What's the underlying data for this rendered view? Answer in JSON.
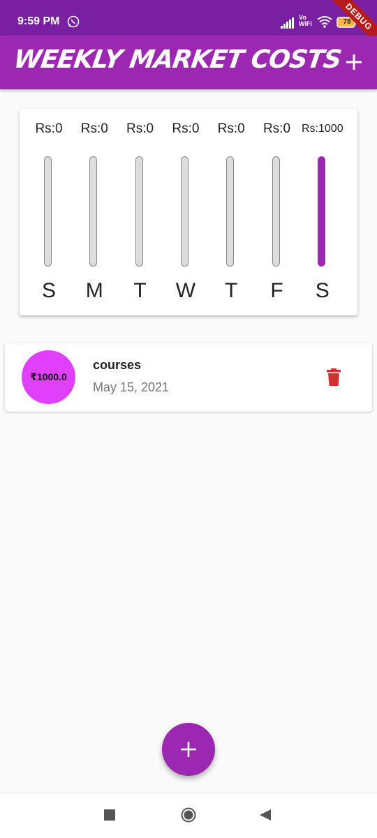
{
  "status_bar": {
    "time": "9:59 PM",
    "network_label": "Vo\nWiFi",
    "battery": "78",
    "debug_banner": "DEBUG"
  },
  "app_bar": {
    "title": "WEEKLY MARKET COSTS",
    "add_icon": "plus-icon"
  },
  "chart": {
    "days": [
      {
        "label": "S",
        "amount": "Rs:0",
        "value": 0
      },
      {
        "label": "M",
        "amount": "Rs:0",
        "value": 0
      },
      {
        "label": "T",
        "amount": "Rs:0",
        "value": 0
      },
      {
        "label": "W",
        "amount": "Rs:0",
        "value": 0
      },
      {
        "label": "T",
        "amount": "Rs:0",
        "value": 0
      },
      {
        "label": "F",
        "amount": "Rs:0",
        "value": 0
      },
      {
        "label": "S",
        "amount": "Rs:1000",
        "value": 1000
      }
    ],
    "max": 1000,
    "bar_color": "#9c27b0",
    "track_color": "#dddddd"
  },
  "transactions": [
    {
      "amount": "₹1000.0",
      "title": "courses",
      "date": "May 15, 2021",
      "delete_icon": "trash-icon"
    }
  ],
  "fab": {
    "icon": "plus-icon"
  },
  "colors": {
    "primary": "#9c27b0",
    "primary_dark": "#7b1fa2",
    "accent": "#e040fb",
    "delete": "#d32f2f"
  }
}
